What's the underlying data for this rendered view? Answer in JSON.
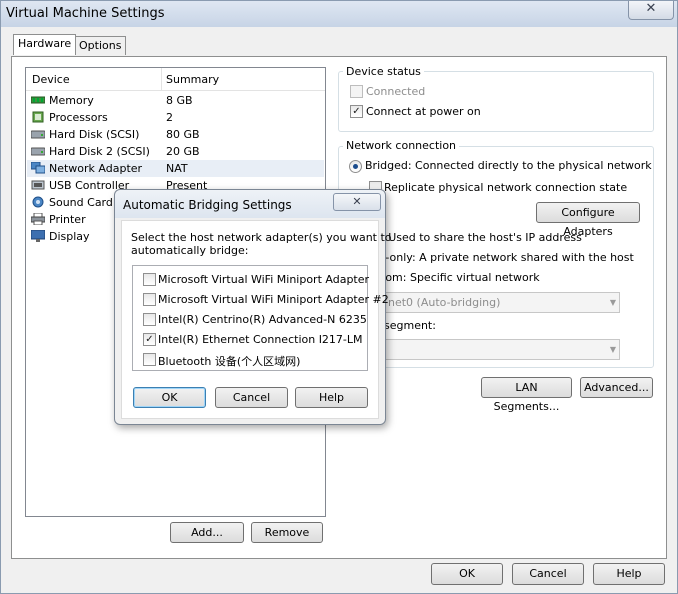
{
  "window": {
    "title": "Virtual Machine Settings",
    "close_glyph": "✕"
  },
  "tabs": [
    {
      "label": "Hardware"
    },
    {
      "label": "Options"
    }
  ],
  "device_list": {
    "col_device": "Device",
    "col_summary": "Summary",
    "rows": [
      {
        "name": "Memory",
        "summary": "8 GB",
        "icon": "memory-icon"
      },
      {
        "name": "Processors",
        "summary": "2",
        "icon": "processor-icon"
      },
      {
        "name": "Hard Disk (SCSI)",
        "summary": "80 GB",
        "icon": "hard-disk-icon"
      },
      {
        "name": "Hard Disk 2 (SCSI)",
        "summary": "20 GB",
        "icon": "hard-disk-icon"
      },
      {
        "name": "Network Adapter",
        "summary": "NAT",
        "icon": "network-adapter-icon"
      },
      {
        "name": "USB Controller",
        "summary": "Present",
        "icon": "usb-icon"
      },
      {
        "name": "Sound Card",
        "summary": "",
        "icon": "sound-card-icon"
      },
      {
        "name": "Printer",
        "summary": "",
        "icon": "printer-icon"
      },
      {
        "name": "Display",
        "summary": "",
        "icon": "display-icon"
      }
    ],
    "selected_row": 4
  },
  "device_buttons": {
    "add": "Add...",
    "remove": "Remove"
  },
  "device_status": {
    "title": "Device status",
    "connected": "Connected",
    "connect_at_power_on": "Connect at power on"
  },
  "network_connection": {
    "title": "Network connection",
    "bridged": "Bridged: Connected directly to the physical network",
    "replicate": "Replicate physical network connection state",
    "configure_adapters": "Configure Adapters",
    "nat": ": Used to share the host's IP address",
    "host_only": "t-only: A private network shared with the host",
    "custom": "tom: Specific virtual network",
    "custom_select": "net0 (Auto-bridging)",
    "lan_segment_label": "segment:",
    "lan_segments_button": "LAN Segments...",
    "advanced_button": "Advanced..."
  },
  "footer_buttons": {
    "ok": "OK",
    "cancel": "Cancel",
    "help": "Help"
  },
  "modal": {
    "title": "Automatic Bridging Settings",
    "close_glyph": "✕",
    "instruction_line1": "Select the host network adapter(s) you want to",
    "instruction_line2": "automatically bridge:",
    "adapters": [
      {
        "label": "Microsoft Virtual WiFi Miniport Adapter",
        "checked": false
      },
      {
        "label": "Microsoft Virtual WiFi Miniport Adapter #2",
        "checked": false
      },
      {
        "label": "Intel(R) Centrino(R) Advanced-N 6235",
        "checked": false
      },
      {
        "label": "Intel(R) Ethernet Connection I217-LM",
        "checked": true
      },
      {
        "label": "Bluetooth 设备(个人区域网)",
        "checked": false
      }
    ],
    "ok": "OK",
    "cancel": "Cancel",
    "help": "Help"
  },
  "colors": {
    "selection": "#e8eef6",
    "default_button_border": "#3c7fb1",
    "radio_dot": "#1a4b8c"
  }
}
